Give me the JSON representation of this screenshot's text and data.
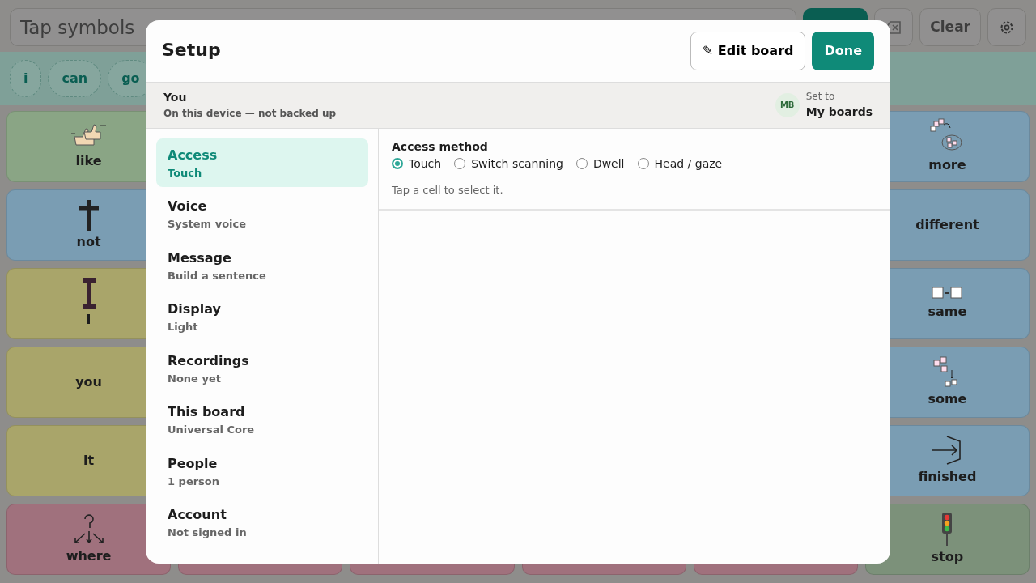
{
  "topbar": {
    "message_placeholder": "Tap symbols",
    "clear_label": "Clear"
  },
  "sentence": [
    {
      "word": "i"
    },
    {
      "word": "can"
    },
    {
      "word": "go"
    }
  ],
  "board": {
    "left_column": [
      {
        "label": "like",
        "kind": "thumbs",
        "color": "#8aa585"
      },
      {
        "label": "not",
        "kind": "cross",
        "color": "#7a9db3"
      },
      {
        "label": "I",
        "kind": "letter",
        "color": "#a9a56a"
      },
      {
        "label": "you",
        "kind": "plain",
        "color": "#a9a56a"
      },
      {
        "label": "it",
        "kind": "plain",
        "color": "#a9a56a"
      },
      {
        "label": "where",
        "kind": "arrows",
        "color": "#a0717d"
      }
    ],
    "bottom_middle": [
      {
        "color": "#a0717d"
      },
      {
        "color": "#a0717d"
      },
      {
        "color": "#a0717d"
      },
      {
        "color": "#a0717d"
      }
    ],
    "right_column": [
      {
        "label": "more",
        "kind": "more",
        "color": "#7a9db3"
      },
      {
        "label": "different",
        "kind": "plain",
        "color": "#7a9db3"
      },
      {
        "label": "same",
        "kind": "same",
        "color": "#7a9db3"
      },
      {
        "label": "some",
        "kind": "some",
        "color": "#7a9db3"
      },
      {
        "label": "finished",
        "kind": "finished",
        "color": "#7a9db3"
      },
      {
        "label": "stop",
        "kind": "traffic",
        "color": "#7c917a"
      }
    ]
  },
  "dialog": {
    "title": "Setup",
    "edit_button": "✎ Edit board",
    "done_button": "Done",
    "profile": {
      "name": "You",
      "detail": "On this device — not backed up",
      "initials": "MB",
      "set_to_label": "Set to",
      "set_to_value": "My boards"
    },
    "sections": [
      {
        "title": "Access",
        "subtitle": "Touch",
        "selected": true
      },
      {
        "title": "Voice",
        "subtitle": "System voice",
        "selected": false
      },
      {
        "title": "Message",
        "subtitle": "Build a sentence",
        "selected": false
      },
      {
        "title": "Display",
        "subtitle": "Light",
        "selected": false
      },
      {
        "title": "Recordings",
        "subtitle": "None yet",
        "selected": false
      },
      {
        "title": "This board",
        "subtitle": "Universal Core",
        "selected": false
      },
      {
        "title": "People",
        "subtitle": "1 person",
        "selected": false
      },
      {
        "title": "Account",
        "subtitle": "Not signed in",
        "selected": false
      }
    ],
    "access_method": {
      "label": "Access method",
      "options": [
        {
          "label": "Touch",
          "selected": true
        },
        {
          "label": "Switch scanning",
          "selected": false
        },
        {
          "label": "Dwell",
          "selected": false
        },
        {
          "label": "Head / gaze",
          "selected": false
        }
      ],
      "hint": "Tap a cell to select it."
    }
  }
}
